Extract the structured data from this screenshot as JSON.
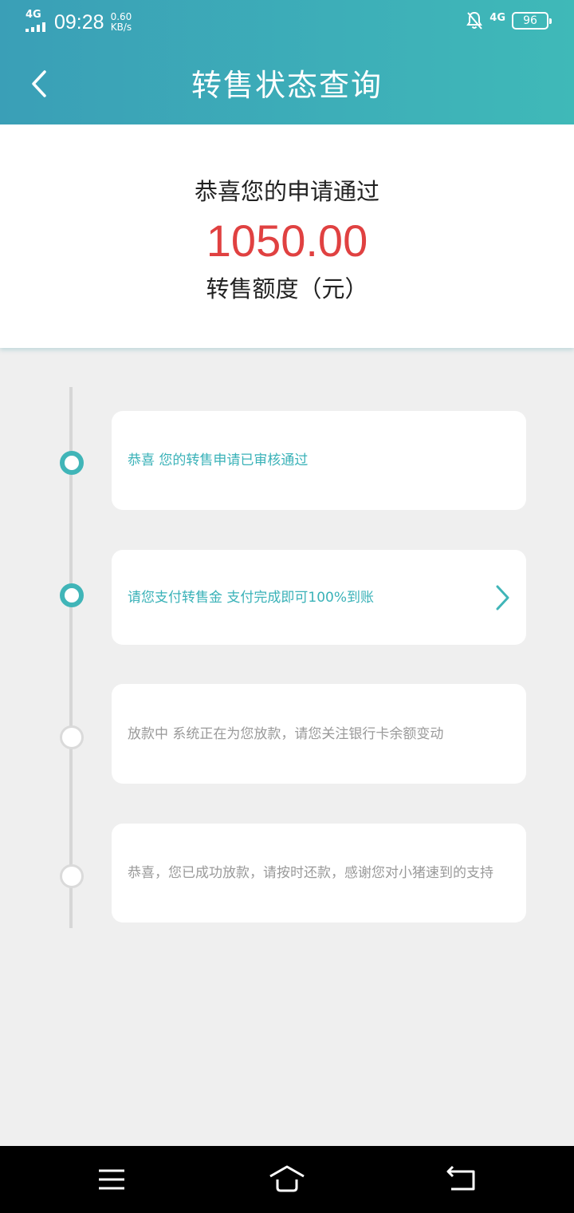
{
  "status_bar": {
    "network_left": "4G",
    "time": "09:28",
    "speed_value": "0.60",
    "speed_unit": "KB/s",
    "network_right": "4G",
    "battery": "96",
    "icons": [
      "signal-icon",
      "bell-off-icon",
      "battery-icon"
    ]
  },
  "header": {
    "title": "转售状态查询",
    "back_icon": "chevron-left-icon"
  },
  "summary": {
    "message": "恭喜您的申请通过",
    "amount": "1050.00",
    "amount_label": "转售额度（元）"
  },
  "steps": [
    {
      "text": "恭喜 您的转售申请已审核通过",
      "state": "active"
    },
    {
      "text": "请您支付转售金 支付完成即可100%到账",
      "state": "active",
      "icon": "chevron-right-icon"
    },
    {
      "text": "放款中 系统正在为您放款，请您关注银行卡余额变动",
      "state": "inactive"
    },
    {
      "text": "恭喜，您已成功放款，请按时还款，感谢您对小猪速到的支持",
      "state": "inactive"
    }
  ],
  "colors": {
    "header_start": "#3a9fb7",
    "header_end": "#3fb9b8",
    "accent": "#40b5b8",
    "amount": "#e04141",
    "inactive_text": "#9a9a9a"
  },
  "nav_bar": {
    "icons": [
      "menu-icon",
      "home-icon",
      "back-icon"
    ]
  }
}
